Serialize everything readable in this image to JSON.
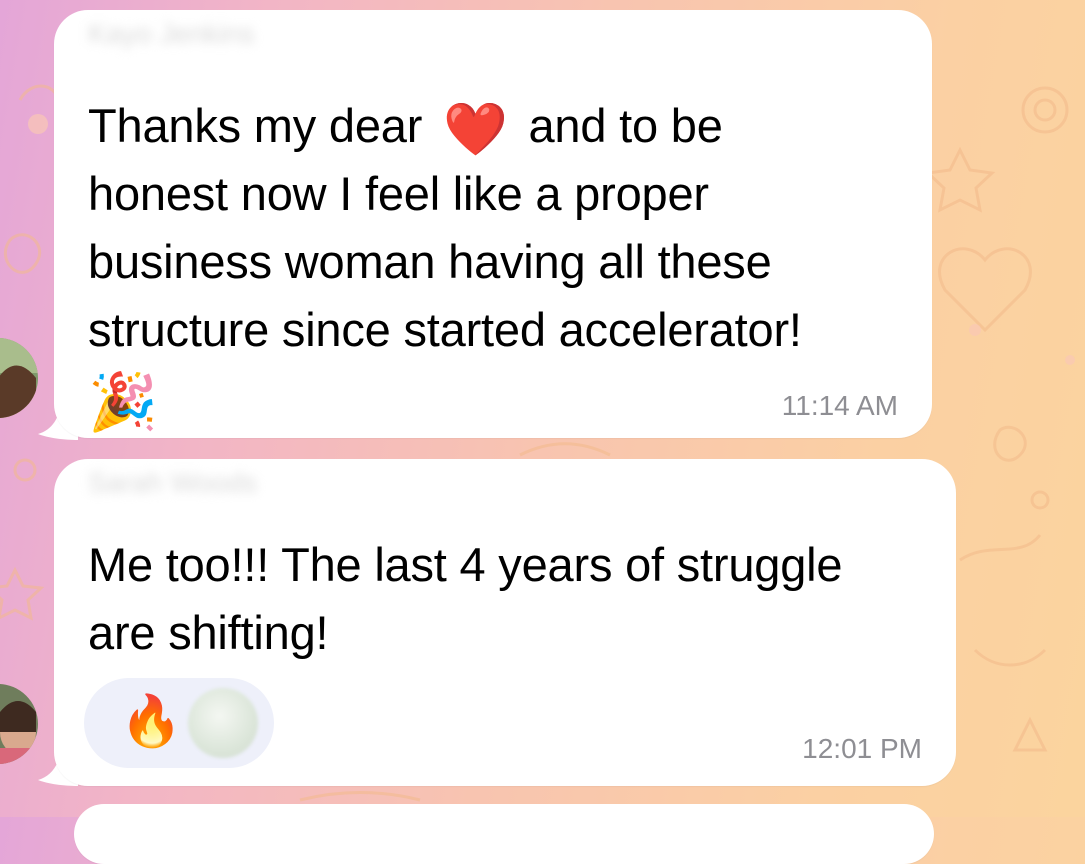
{
  "chat": {
    "messages": [
      {
        "sender": "Kayo Jenkins",
        "lines": [
          "Thanks my dear",
          "and to be",
          "honest now I feel like a proper",
          "business woman having all these",
          "structure since started accelerator!"
        ],
        "emoji_inline": "❤️",
        "emoji_trailing": "🎉",
        "time": "11:14 AM"
      },
      {
        "sender": "Sarah Woods",
        "lines": [
          "Me too!!! The last 4 years of struggle",
          "are shifting!"
        ],
        "reaction": {
          "emoji": "🔥"
        },
        "time": "12:01 PM"
      }
    ]
  },
  "colors": {
    "bubble": "#ffffff",
    "time": "#8e8e93",
    "reaction_pill": "#eef0fa"
  },
  "icons": [
    "heart-emoji",
    "party-popper-emoji",
    "fire-emoji",
    "user-avatar"
  ]
}
